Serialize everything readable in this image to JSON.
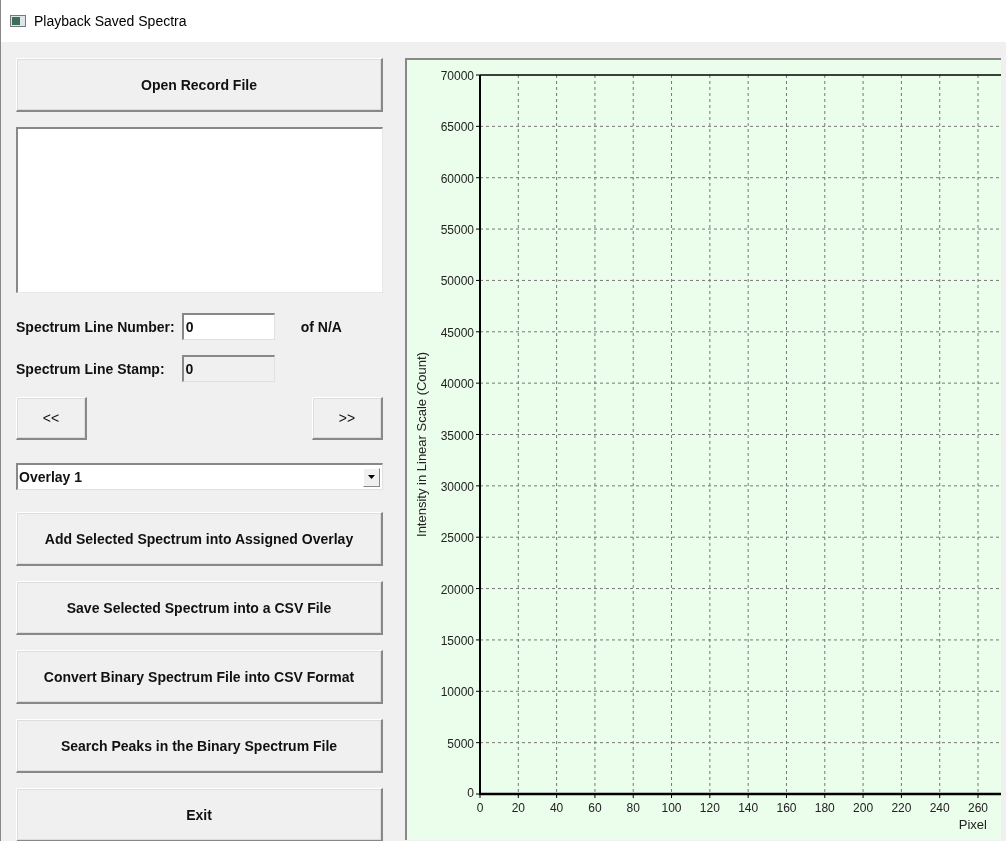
{
  "window": {
    "title": "Playback Saved Spectra"
  },
  "open_button": "Open Record File",
  "line_number": {
    "label": "Spectrum Line Number:",
    "value": "0",
    "total": "of N/A"
  },
  "line_stamp": {
    "label": "Spectrum Line Stamp:",
    "value": "0",
    "disabled": true
  },
  "nav_buttons": [
    "<<",
    ">>"
  ],
  "overlay_select": {
    "value": "Overlay 1"
  },
  "action_buttons": [
    "Add Selected Spectrum into Assigned Overlay",
    "Save Selected Spectrum into a CSV File",
    "Convert Binary Spectrum File into CSV Format",
    "Search Peaks in the Binary Spectrum File",
    "Exit"
  ],
  "chart": {
    "chart_data": {
      "type": "line",
      "grid": true,
      "xlabel": "Pixel",
      "ylabel": "Intensity in Linear Scale (Count)",
      "xlim": [
        0,
        272
      ],
      "ylim": [
        0,
        70000
      ],
      "xticks": [
        0,
        20,
        40,
        60,
        80,
        100,
        120,
        140,
        160,
        180,
        200,
        220,
        240,
        260
      ],
      "yticks": [
        0,
        5000,
        10000,
        15000,
        20000,
        25000,
        30000,
        35000,
        40000,
        45000,
        50000,
        55000,
        60000,
        65000,
        70000
      ]
    }
  }
}
